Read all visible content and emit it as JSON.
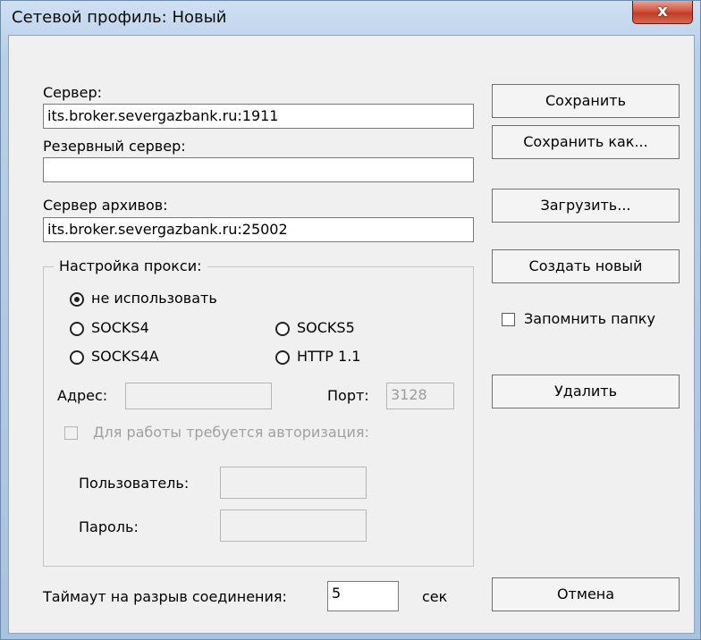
{
  "window": {
    "title": "Сетевой профиль: Новый",
    "close_glyph": "x"
  },
  "server": {
    "label": "Сервер:",
    "value": "its.broker.severgazbank.ru:1911"
  },
  "backup_server": {
    "label": "Резервный сервер:",
    "value": ""
  },
  "archive_server": {
    "label": "Сервер архивов:",
    "value": "its.broker.severgazbank.ru:25002"
  },
  "proxy": {
    "group_label": "Настройка прокси:",
    "options": {
      "none": "не использовать",
      "socks4": "SOCKS4",
      "socks5": "SOCKS5",
      "socks4a": "SOCKS4A",
      "http11": "HTTP 1.1"
    },
    "selected": "none",
    "address_label": "Адрес:",
    "address_value": "",
    "port_label": "Порт:",
    "port_value": "3128",
    "auth_label": "Для работы требуется авторизация:",
    "user_label": "Пользователь:",
    "user_value": "",
    "password_label": "Пароль:",
    "password_value": ""
  },
  "timeout": {
    "label": "Таймаут на разрыв соединения:",
    "value": "5",
    "unit": "сек"
  },
  "buttons": {
    "save": "Сохранить",
    "save_as": "Сохранить как...",
    "load": "Загрузить...",
    "create_new": "Создать новый",
    "remember_folder": "Запомнить папку",
    "delete": "Удалить",
    "cancel": "Отмена"
  }
}
